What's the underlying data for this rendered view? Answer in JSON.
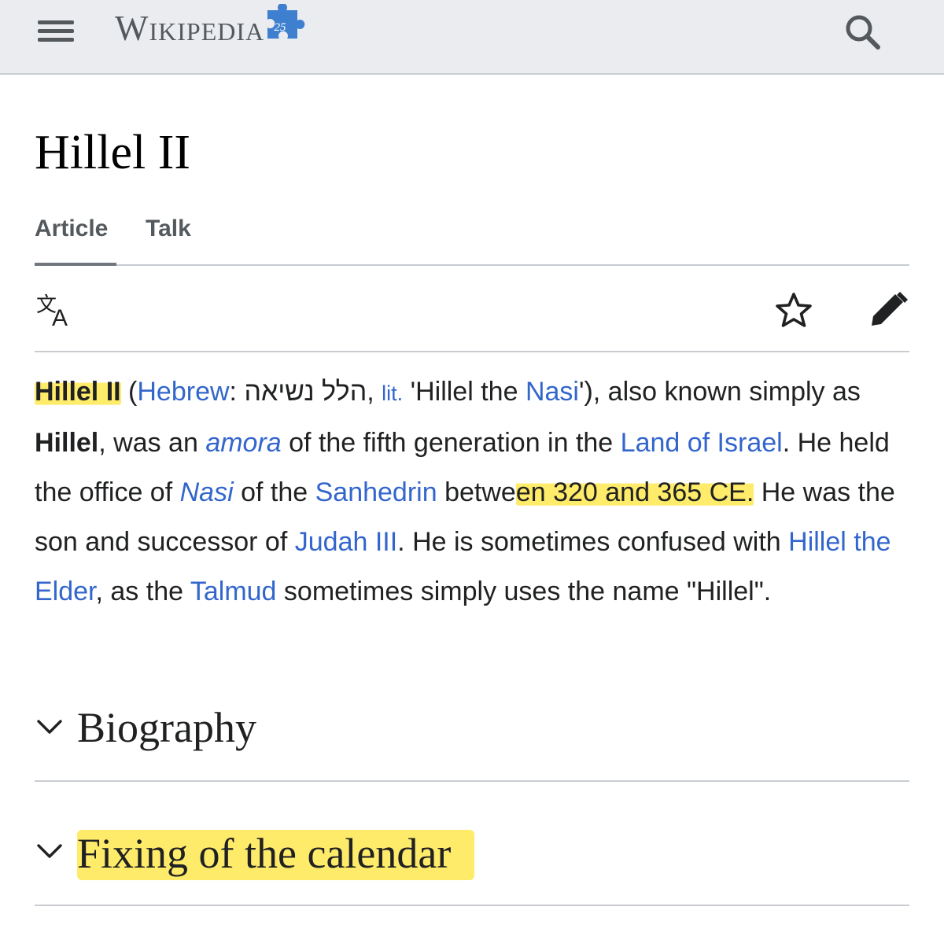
{
  "header": {
    "logo_text": "Wikipedia",
    "logo_badge_number": "25",
    "menu_icon": "hamburger-menu-icon",
    "search_icon": "search-icon"
  },
  "page": {
    "title": "Hillel II",
    "tabs": [
      {
        "label": "Article",
        "selected": true
      },
      {
        "label": "Talk",
        "selected": false
      }
    ],
    "toolbar_icons": [
      "language-icon",
      "star-icon",
      "edit-pencil-icon"
    ]
  },
  "lead": {
    "name": "Hillel II",
    "paren_open": " (",
    "link_hebrew": "Hebrew",
    "colon": ": ",
    "hebrew_text": "הלל נשיאה",
    "comma": ", ",
    "lit": "lit.",
    "quote_start": " 'Hillel the ",
    "link_nasi": "Nasi",
    "after_nasi": "'), also known simply as ",
    "bold_hillel": "Hillel",
    "was_an": ", was an ",
    "link_amora": "amora",
    "fifth_gen": " of the fifth generation in the ",
    "link_land": "Land of Israel",
    "held_office": ". He held the office of ",
    "link_nasi2": "Nasi",
    "of_the": " of the ",
    "link_sanhedrin": "Sanhedrin",
    "between": " betwe",
    "highlighted_dates": "en 320 and 365 CE.",
    "son_of": " He was the son and successor of ",
    "link_judah": "Judah III",
    "confused": ". He is sometimes confused with ",
    "link_elder": "Hillel the Elder",
    "as_the": ", as the ",
    "link_talmud": "Talmud",
    "closing": " sometimes simply uses the name \"Hillel\"."
  },
  "sections": [
    {
      "title": "Biography",
      "highlighted": false
    },
    {
      "title": "Fixing of the calendar",
      "highlighted": true
    }
  ],
  "colors": {
    "link": "#3366cc",
    "highlight": "#ffe850",
    "header_bg": "#eaecf0",
    "text": "#202122"
  }
}
